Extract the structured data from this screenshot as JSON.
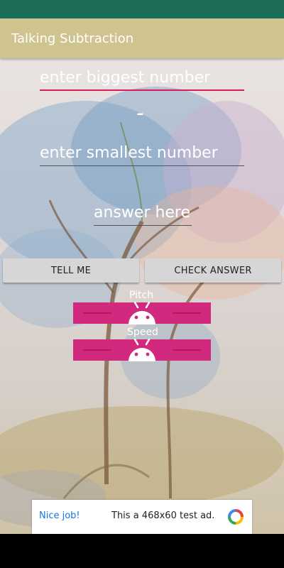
{
  "app": {
    "title": "Talking Subtraction"
  },
  "form": {
    "biggest_placeholder": "enter biggest number",
    "minus_sign": "-",
    "smallest_placeholder": "enter smallest number",
    "answer_placeholder": "answer here"
  },
  "buttons": {
    "tell_me": "TELL ME",
    "check_answer": "CHECK ANSWER"
  },
  "sliders": {
    "pitch": {
      "label": "Pitch",
      "value": 0.5
    },
    "speed": {
      "label": "Speed",
      "value": 0.5
    }
  },
  "ad": {
    "badge": "Nice job!",
    "text": "This a 468x60 test ad."
  },
  "colors": {
    "status_bar": "#1d6e59",
    "app_bar": "#cfc48f",
    "accent": "#d81b60",
    "slider": "#d1297e",
    "button": "#d6d6d6",
    "android_thumb": "#ffffff"
  },
  "icons": {
    "slider_thumb": "android-robot-icon",
    "ad_logo": "ad-choice-icon"
  }
}
